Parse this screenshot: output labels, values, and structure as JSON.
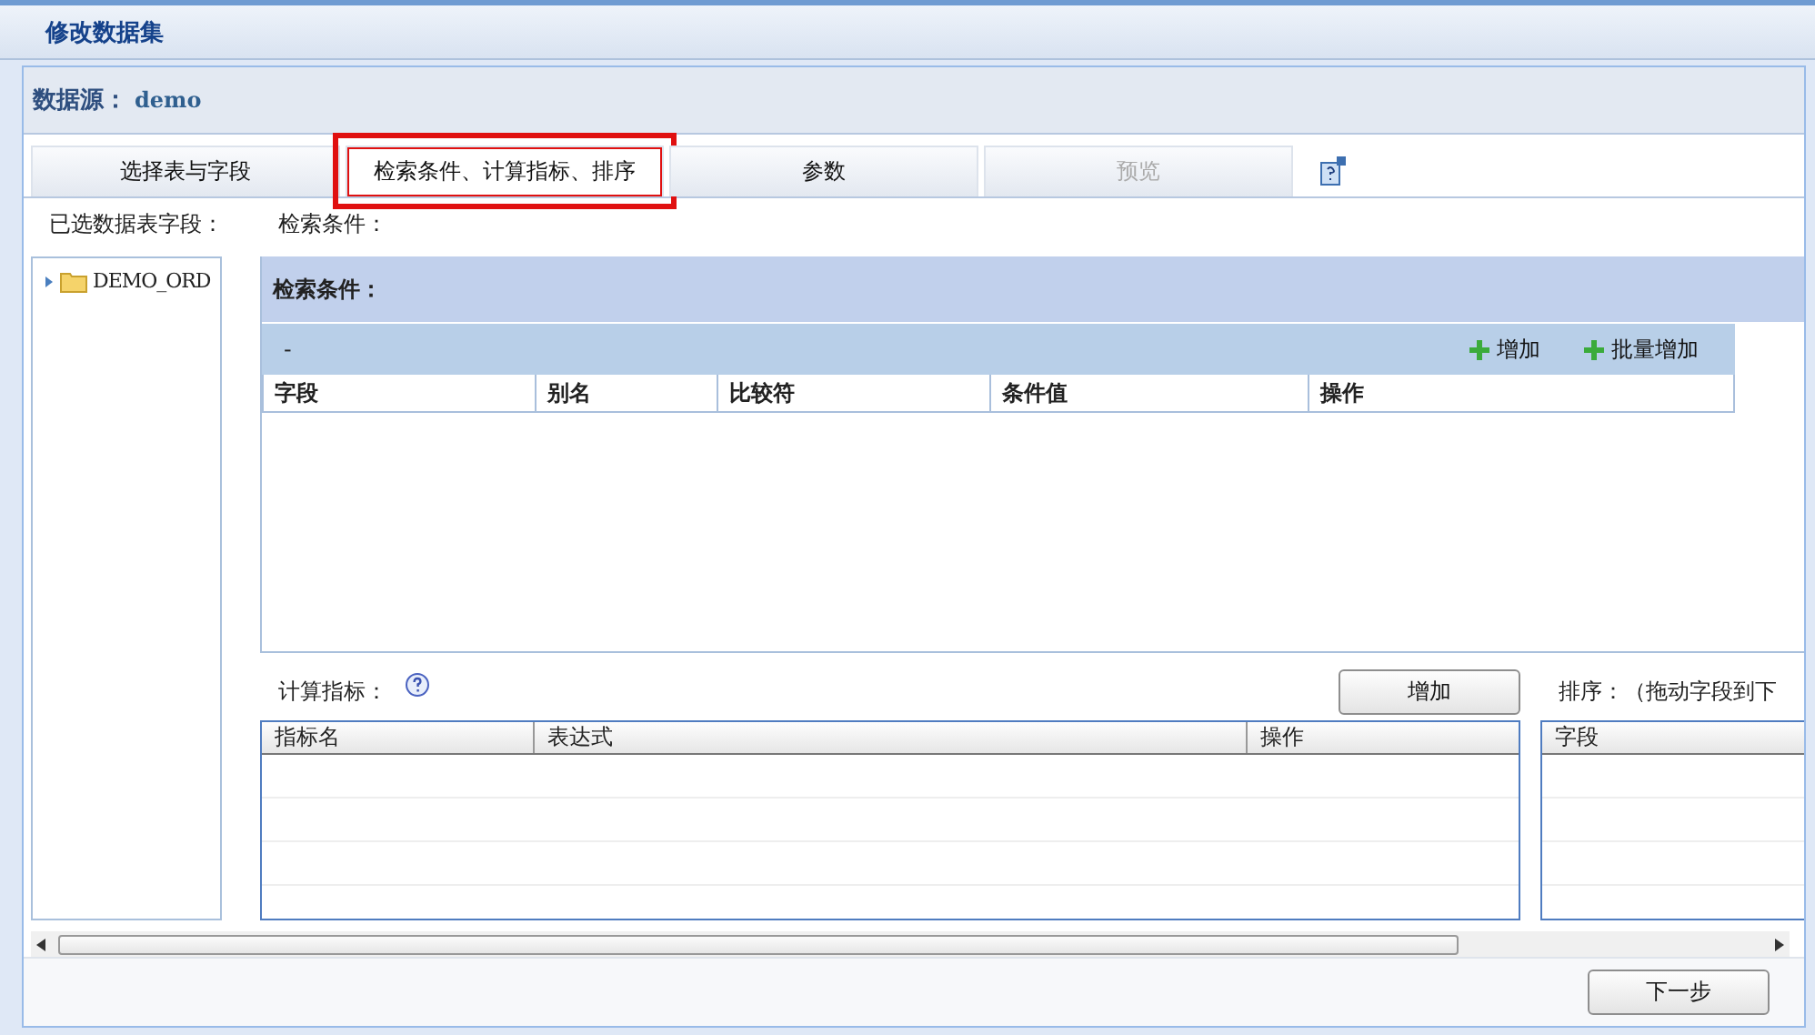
{
  "window": {
    "title": "修改数据集"
  },
  "datasource": {
    "label": "数据源：",
    "value": "demo"
  },
  "tabs": [
    {
      "label": "选择表与字段",
      "selected": false,
      "disabled": false
    },
    {
      "label": "检索条件、计算指标、排序",
      "selected": true,
      "disabled": false
    },
    {
      "label": "参数",
      "selected": false,
      "disabled": false
    },
    {
      "label": "预览",
      "selected": false,
      "disabled": true
    }
  ],
  "left_panel": {
    "label": "已选数据表字段：",
    "tree": [
      {
        "label": "DEMO_ORD",
        "expanded": false
      }
    ]
  },
  "search": {
    "label": "检索条件：",
    "panel_title": "检索条件：",
    "toolbar_text": "-",
    "actions": [
      "增加",
      "批量增加"
    ],
    "columns": [
      "字段",
      "别名",
      "比较符",
      "条件值",
      "操作"
    ]
  },
  "metrics": {
    "label": "计算指标：",
    "add_button": "增加",
    "columns": [
      "指标名",
      "表达式",
      "操作"
    ]
  },
  "sort": {
    "label": "排序：（拖动字段到下",
    "columns": [
      "字段"
    ]
  },
  "footer": {
    "next_button": "下一步"
  }
}
